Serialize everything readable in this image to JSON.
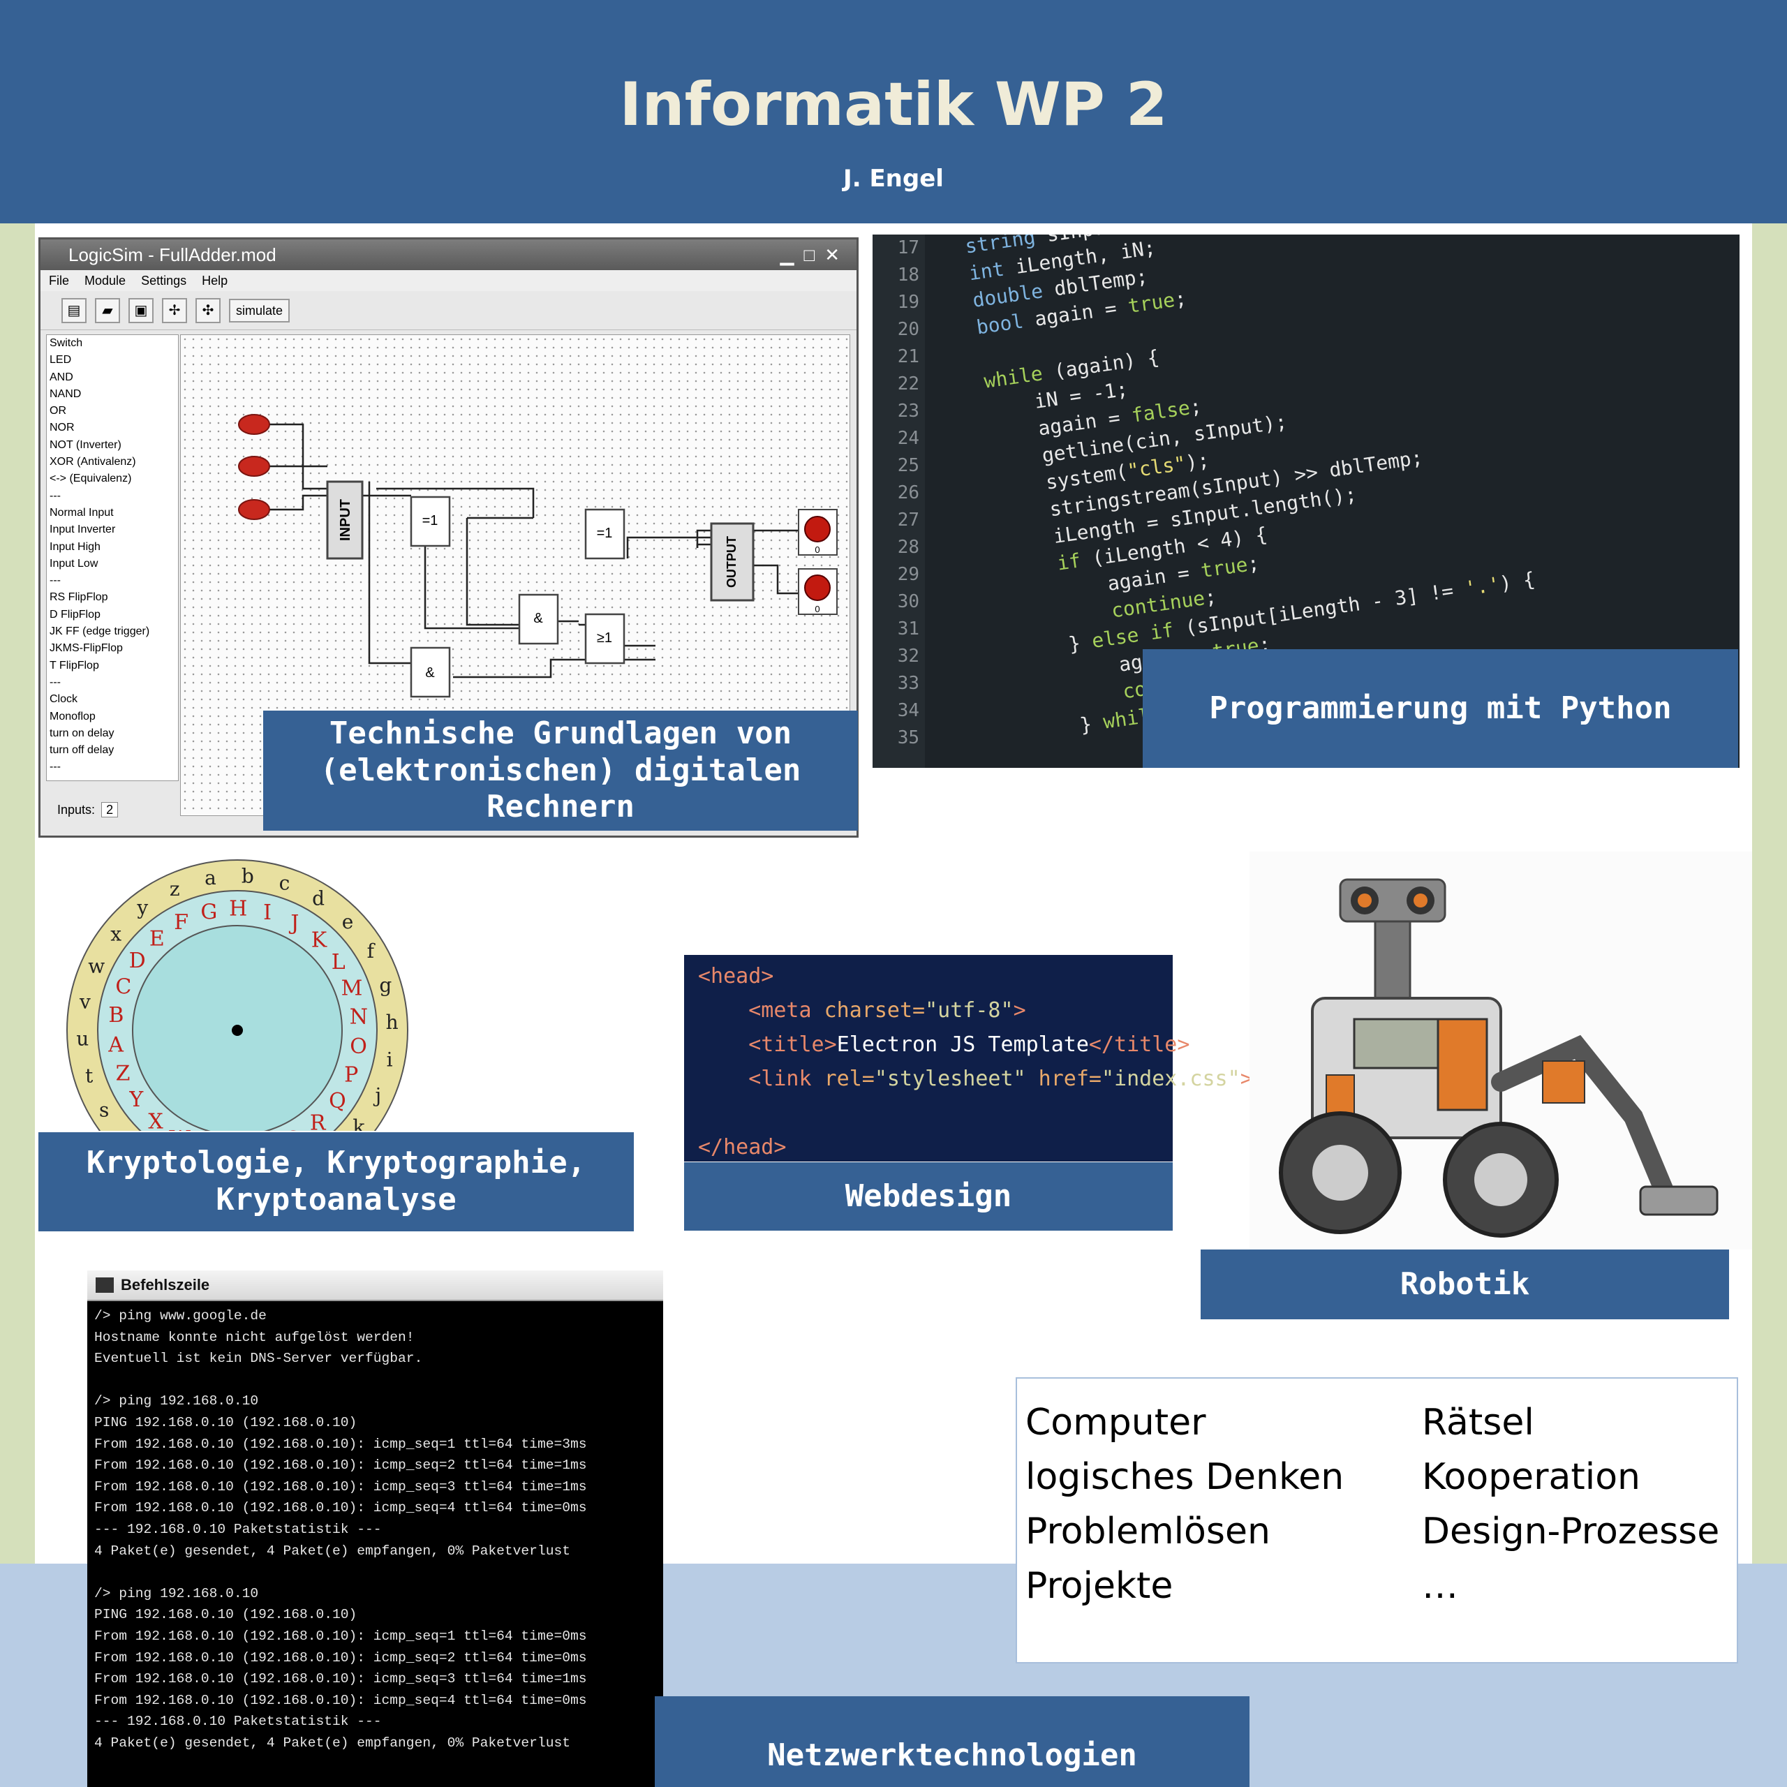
{
  "header": {
    "title": "Informatik WP 2",
    "author": "J. Engel"
  },
  "labels": {
    "technik": "Technische Grundlagen von (elektronischen) digitalen Rechnern",
    "python": "Programmierung mit Python",
    "krypto": "Kryptologie, Kryptographie, Kryptoanalyse",
    "webdesign": "Webdesign",
    "robotik": "Robotik",
    "netzwerk": "Netzwerktechnologien"
  },
  "logicsim": {
    "window_title": "LogicSim - FullAdder.mod",
    "menu": [
      "File",
      "Module",
      "Settings",
      "Help"
    ],
    "simulate_label": "simulate",
    "components": [
      "Switch",
      "LED",
      "AND",
      "NAND",
      "OR",
      "NOR",
      "NOT (Inverter)",
      "XOR (Antivalenz)",
      "<-> (Equivalenz)",
      "---",
      "Normal Input",
      "Input Inverter",
      "Input High",
      "Input Low",
      "---",
      "RS FlipFlop",
      "D FlipFlop",
      "JK FF (edge trigger)",
      "JKMS-FlipFlop",
      "T FlipFlop",
      "---",
      "Clock",
      "Monoflop",
      "turn on delay",
      "turn off delay",
      "---"
    ],
    "inputs_label": "Inputs:",
    "inputs_value": "2",
    "gates": {
      "input": "INPUT",
      "output": "OUTPUT",
      "xor1": "=1",
      "xor2": "=1",
      "and1": "&",
      "and2": "&",
      "or1": "≥1"
    },
    "switch_value": "0",
    "led_value": "0"
  },
  "code_editor": {
    "line_numbers": [
      "17",
      "18",
      "19",
      "20",
      "21",
      "22",
      "23",
      "24",
      "25",
      "26",
      "27",
      "28",
      "29",
      "30",
      "31",
      "32",
      "33",
      "34",
      "35"
    ]
  },
  "webcode": {
    "l1_tag": "<head>",
    "l2_open": "<meta",
    "l2_attr": " charset=",
    "l2_val": "\"utf-8\"",
    "l2_close": ">",
    "l3_open": "<title>",
    "l3_text": "Electron JS Template",
    "l3_close": "</title>",
    "l4_open": "<link",
    "l4_attr1": " rel=",
    "l4_val1": "\"stylesheet\"",
    "l4_attr2": " href=",
    "l4_val2": "\"index.css\"",
    "l4_close": ">",
    "l5_tag": "</head>"
  },
  "terminal": {
    "title": "Befehlszeile",
    "lines": [
      "/> ping www.google.de",
      "Hostname konnte nicht aufgelöst werden!",
      "Eventuell ist kein DNS-Server verfügbar.",
      "",
      "/> ping 192.168.0.10",
      "PING 192.168.0.10 (192.168.0.10)",
      "From 192.168.0.10 (192.168.0.10): icmp_seq=1 ttl=64 time=3ms",
      "From 192.168.0.10 (192.168.0.10): icmp_seq=2 ttl=64 time=1ms",
      "From 192.168.0.10 (192.168.0.10): icmp_seq=3 ttl=64 time=1ms",
      "From 192.168.0.10 (192.168.0.10): icmp_seq=4 ttl=64 time=0ms",
      "--- 192.168.0.10 Paketstatistik ---",
      "4 Paket(e) gesendet, 4 Paket(e) empfangen, 0% Paketverlust",
      "",
      "/> ping 192.168.0.10",
      "PING 192.168.0.10 (192.168.0.10)",
      "From 192.168.0.10 (192.168.0.10): icmp_seq=1 ttl=64 time=0ms",
      "From 192.168.0.10 (192.168.0.10): icmp_seq=2 ttl=64 time=0ms",
      "From 192.168.0.10 (192.168.0.10): icmp_seq=3 ttl=64 time=1ms",
      "From 192.168.0.10 (192.168.0.10): icmp_seq=4 ttl=64 time=0ms",
      "--- 192.168.0.10 Paketstatistik ---",
      "4 Paket(e) gesendet, 4 Paket(e) empfangen, 0% Paketverlust"
    ]
  },
  "topics": {
    "left": [
      "Computer",
      "logisches Denken",
      "Problemlösen",
      "Projekte"
    ],
    "right": [
      "Rätsel",
      "Kooperation",
      "Design-Prozesse",
      "…"
    ]
  },
  "cipher": {
    "outer": "abcdefghijklmnopqrstuvwxyz",
    "inner": "DEFGHIJKLMNOPQRSTUVWXYZABC"
  },
  "colors": {
    "header_bg": "#366194",
    "title_text": "#f0ecd8",
    "side_green": "#d5e0bb",
    "bottom_band": "#b8cce4",
    "label_bg": "#366194"
  }
}
